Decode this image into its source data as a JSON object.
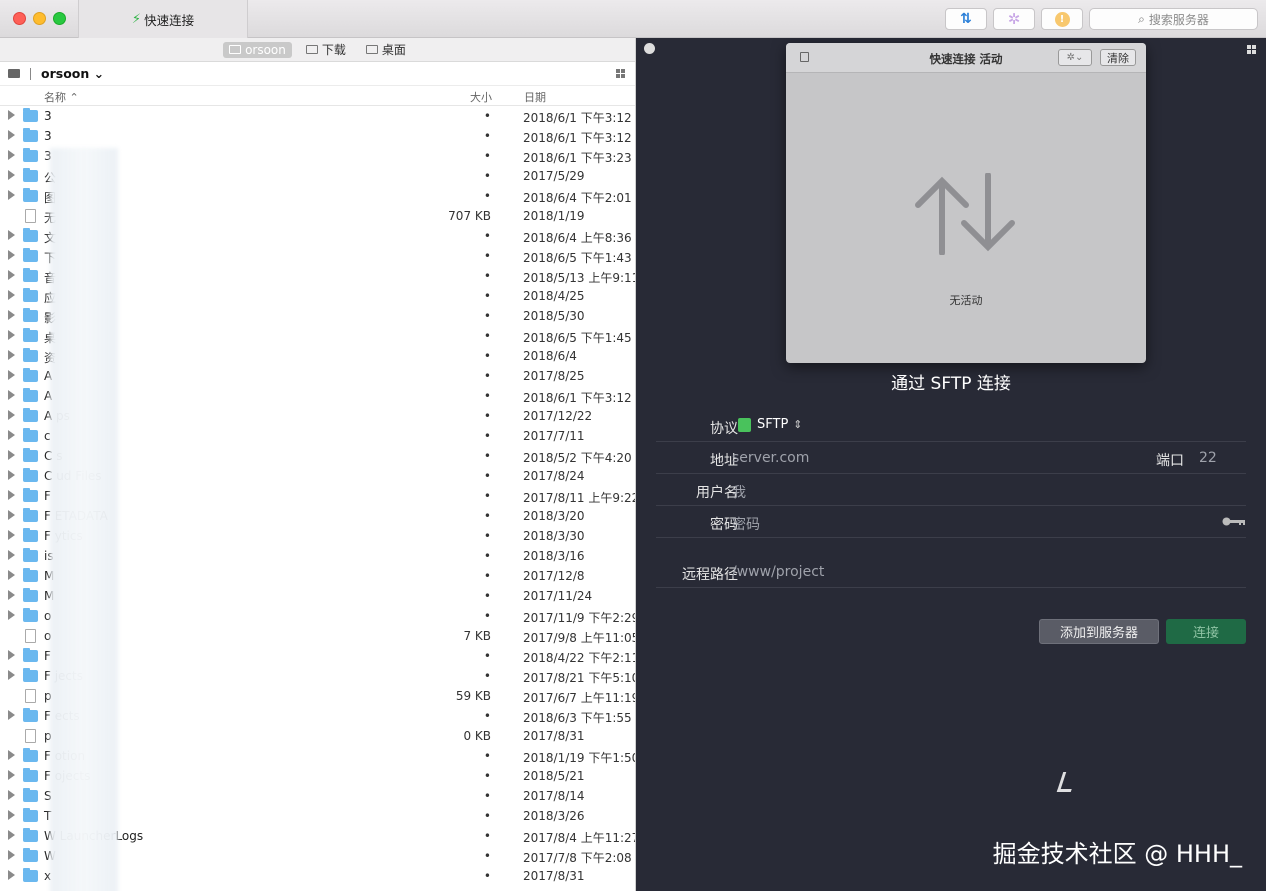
{
  "window": {
    "tab_title": "快速连接",
    "search_placeholder": "搜索服务器"
  },
  "left": {
    "breadcrumbs": [
      {
        "label": "orsoon",
        "active": true
      },
      {
        "label": "下载",
        "active": false
      },
      {
        "label": "桌面",
        "active": false
      }
    ],
    "current_user": "orsoon",
    "columns": {
      "name": "名称",
      "size": "大小",
      "date": "日期"
    },
    "files": [
      {
        "name": "3",
        "size": "•",
        "date": "2018/6/1 下午3:12",
        "type": "folder"
      },
      {
        "name": "3",
        "size": "•",
        "date": "2018/6/1 下午3:12",
        "type": "folder"
      },
      {
        "name": "3",
        "size": "•",
        "date": "2018/6/1 下午3:23",
        "type": "folder"
      },
      {
        "name": "公",
        "size": "•",
        "date": "2017/5/29",
        "type": "folder"
      },
      {
        "name": "图",
        "size": "•",
        "date": "2018/6/4 下午2:01",
        "type": "folder"
      },
      {
        "name": "无",
        "size": "707 KB",
        "date": "2018/1/19",
        "type": "file"
      },
      {
        "name": "文",
        "size": "•",
        "date": "2018/6/4 上午8:36",
        "type": "folder"
      },
      {
        "name": "下",
        "size": "•",
        "date": "2018/6/5 下午1:43",
        "type": "folder"
      },
      {
        "name": "音",
        "size": "•",
        "date": "2018/5/13 上午9:11",
        "type": "folder"
      },
      {
        "name": "应",
        "size": "•",
        "date": "2018/4/25",
        "type": "folder"
      },
      {
        "name": "影",
        "size": "•",
        "date": "2018/5/30",
        "type": "folder"
      },
      {
        "name": "桌",
        "size": "•",
        "date": "2018/6/5 下午1:45",
        "type": "folder"
      },
      {
        "name": "资",
        "size": "•",
        "date": "2018/6/4",
        "type": "folder"
      },
      {
        "name": "A",
        "size": "•",
        "date": "2017/8/25",
        "type": "folder"
      },
      {
        "name": "A",
        "size": "•",
        "date": "2018/6/1 下午3:12",
        "type": "folder"
      },
      {
        "name": "A            ps",
        "size": "•",
        "date": "2017/12/22",
        "type": "folder"
      },
      {
        "name": "c",
        "size": "•",
        "date": "2017/7/11",
        "type": "folder"
      },
      {
        "name": "C            s",
        "size": "•",
        "date": "2018/5/2 下午4:20",
        "type": "folder"
      },
      {
        "name": "C            ud Files",
        "size": "•",
        "date": "2017/8/24",
        "type": "folder"
      },
      {
        "name": "F",
        "size": "•",
        "date": "2017/8/11 上午9:22",
        "type": "folder"
      },
      {
        "name": "F            ETADATA",
        "size": "•",
        "date": "2018/3/20",
        "type": "folder"
      },
      {
        "name": "F            ytics",
        "size": "•",
        "date": "2018/3/30",
        "type": "folder"
      },
      {
        "name": "is",
        "size": "•",
        "date": "2018/3/16",
        "type": "folder"
      },
      {
        "name": "M",
        "size": "•",
        "date": "2017/12/8",
        "type": "folder"
      },
      {
        "name": "M",
        "size": "•",
        "date": "2017/11/24",
        "type": "folder"
      },
      {
        "name": "o",
        "size": "•",
        "date": "2017/11/9 下午2:29",
        "type": "folder"
      },
      {
        "name": "o",
        "size": "7 KB",
        "date": "2017/9/8 上午11:05",
        "type": "file"
      },
      {
        "name": "F",
        "size": "•",
        "date": "2018/4/22 下午2:11",
        "type": "folder"
      },
      {
        "name": "F            jects",
        "size": "•",
        "date": "2017/8/21 下午5:10",
        "type": "folder"
      },
      {
        "name": "p",
        "size": "59 KB",
        "date": "2017/6/7 上午11:19",
        "type": "file"
      },
      {
        "name": "F            ects",
        "size": "•",
        "date": "2018/6/3 下午1:55",
        "type": "folder"
      },
      {
        "name": "p",
        "size": "0 KB",
        "date": "2017/8/31",
        "type": "file"
      },
      {
        "name": "F            otion",
        "size": "•",
        "date": "2018/1/19 下午1:50",
        "type": "folder"
      },
      {
        "name": "F            ojects",
        "size": "•",
        "date": "2018/5/21",
        "type": "folder"
      },
      {
        "name": "S",
        "size": "•",
        "date": "2017/8/14",
        "type": "folder"
      },
      {
        "name": "T",
        "size": "•",
        "date": "2018/3/26",
        "type": "folder"
      },
      {
        "name": "W            LauncherLogs",
        "size": "•",
        "date": "2017/8/4 上午11:27",
        "type": "folder"
      },
      {
        "name": "W",
        "size": "•",
        "date": "2017/7/8 下午2:08",
        "type": "folder"
      },
      {
        "name": "x",
        "size": "•",
        "date": "2017/8/31",
        "type": "folder"
      }
    ]
  },
  "activity": {
    "title": "快速连接 活动",
    "clear_label": "清除",
    "empty_text": "无活动"
  },
  "connect_form": {
    "title": "通过 SFTP 连接",
    "protocol_label": "协议",
    "protocol_value": "SFTP",
    "address_label": "地址",
    "address_placeholder": "server.com",
    "port_label": "端口",
    "port_placeholder": "22",
    "username_label": "用户名",
    "username_placeholder": "我",
    "password_label": "密码",
    "password_placeholder": "密码",
    "remote_path_label": "远程路径",
    "remote_path_placeholder": "/www/project",
    "add_button": "添加到服务器",
    "connect_button": "连接"
  },
  "watermark": "掘金技术社区 @ HHH_",
  "colors": {
    "right_bg": "#282a36",
    "folder": "#6bb8ef",
    "connect_green": "#1f6a45",
    "protocol_green": "#49c25c"
  }
}
